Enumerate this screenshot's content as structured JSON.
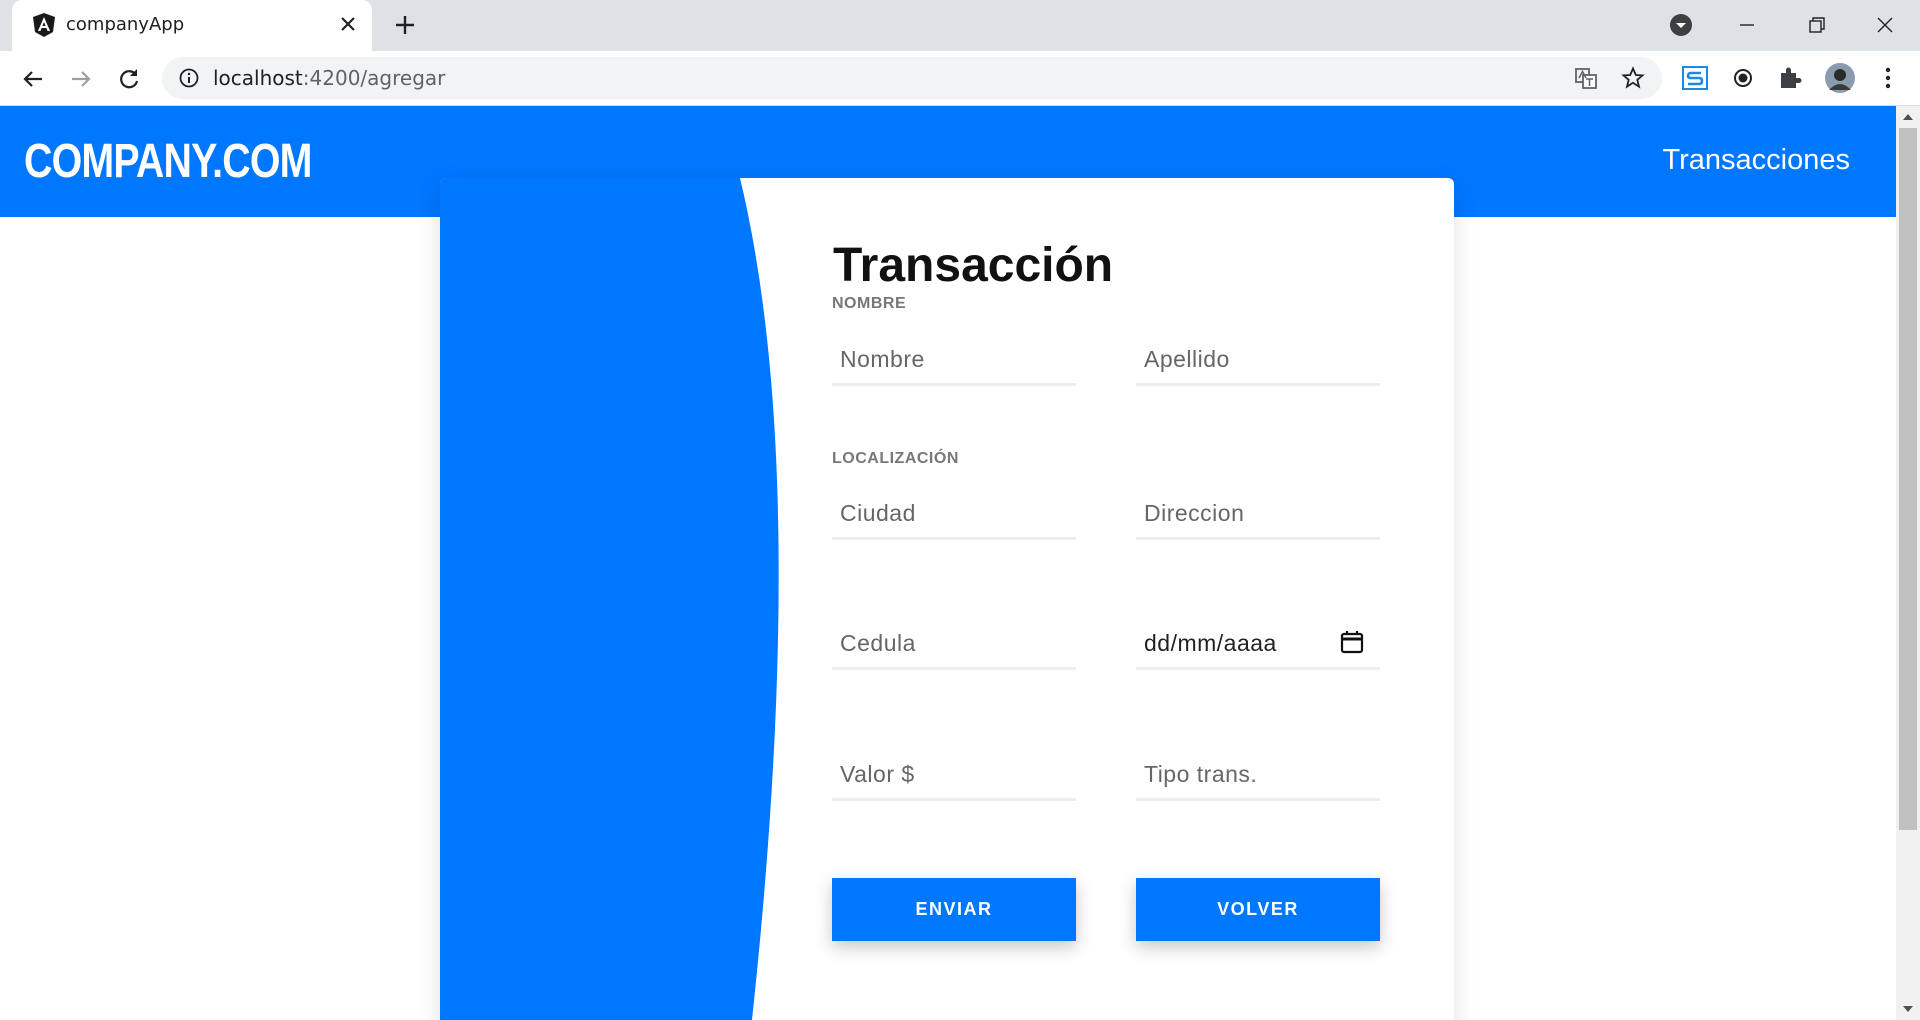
{
  "browser": {
    "tab_title": "companyApp",
    "url_host": "localhost",
    "url_path": ":4200/agregar"
  },
  "navbar": {
    "brand": "COMPANY.COM",
    "link": "Transacciones"
  },
  "form": {
    "title": "Transacción",
    "section_name": "NOMBRE",
    "section_location": "LOCALIZACIÓN",
    "fields": {
      "nombre": "Nombre",
      "apellido": "Apellido",
      "ciudad": "Ciudad",
      "direccion": "Direccion",
      "cedula": "Cedula",
      "fecha": "dd/mm/aaaa",
      "valor": "Valor $",
      "tipo": "Tipo trans."
    },
    "submit_label": "ENVIAR",
    "back_label": "VOLVER"
  },
  "colors": {
    "brand_blue": "#0077ff"
  }
}
